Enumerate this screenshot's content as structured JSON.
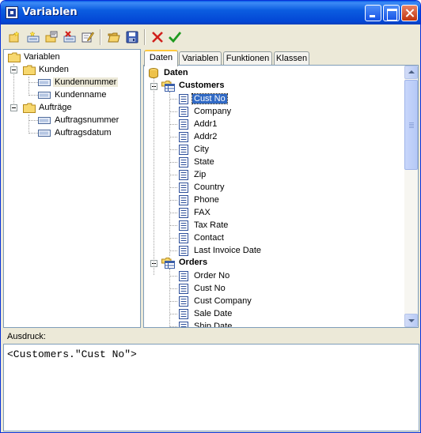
{
  "window": {
    "title": "Variablen"
  },
  "toolbar": {
    "buttons": [
      {
        "name": "new-folder",
        "icon": "new-folder-icon"
      },
      {
        "name": "new-variable",
        "icon": "new-variable-icon"
      },
      {
        "name": "variable-properties",
        "icon": "folder-properties-icon"
      },
      {
        "name": "delete-variable",
        "icon": "delete-variable-icon"
      },
      {
        "name": "edit-variable",
        "icon": "edit-icon"
      },
      {
        "name": "open",
        "icon": "open-folder-icon"
      },
      {
        "name": "save",
        "icon": "save-icon"
      },
      {
        "name": "cancel",
        "icon": "cancel-icon"
      },
      {
        "name": "ok",
        "icon": "checkmark-icon"
      }
    ]
  },
  "left_tree": {
    "root": "Variablen",
    "groups": [
      {
        "label": "Kunden",
        "items": [
          "Kundennummer",
          "Kundenname"
        ]
      },
      {
        "label": "Aufträge",
        "items": [
          "Auftragsnummer",
          "Auftragsdatum"
        ]
      }
    ],
    "selected": "Kundennummer"
  },
  "tabs": [
    "Daten",
    "Variablen",
    "Funktionen",
    "Klassen"
  ],
  "active_tab": "Daten",
  "right_tree": {
    "root": "Daten",
    "tables": [
      {
        "name": "Customers",
        "fields": [
          "Cust No",
          "Company",
          "Addr1",
          "Addr2",
          "City",
          "State",
          "Zip",
          "Country",
          "Phone",
          "FAX",
          "Tax Rate",
          "Contact",
          "Last Invoice Date"
        ]
      },
      {
        "name": "Orders",
        "fields": [
          "Order No",
          "Cust No",
          "Cust Company",
          "Sale Date",
          "Ship Date"
        ]
      }
    ],
    "selected": "Cust No"
  },
  "ausdruck": {
    "label": "Ausdruck:",
    "value": "<Customers.\"Cust No\">"
  },
  "colors": {
    "titlebar": "#0346d5",
    "selection": "#316ac5",
    "window_bg": "#ece9d8",
    "tab_highlight": "#ffc83c"
  }
}
